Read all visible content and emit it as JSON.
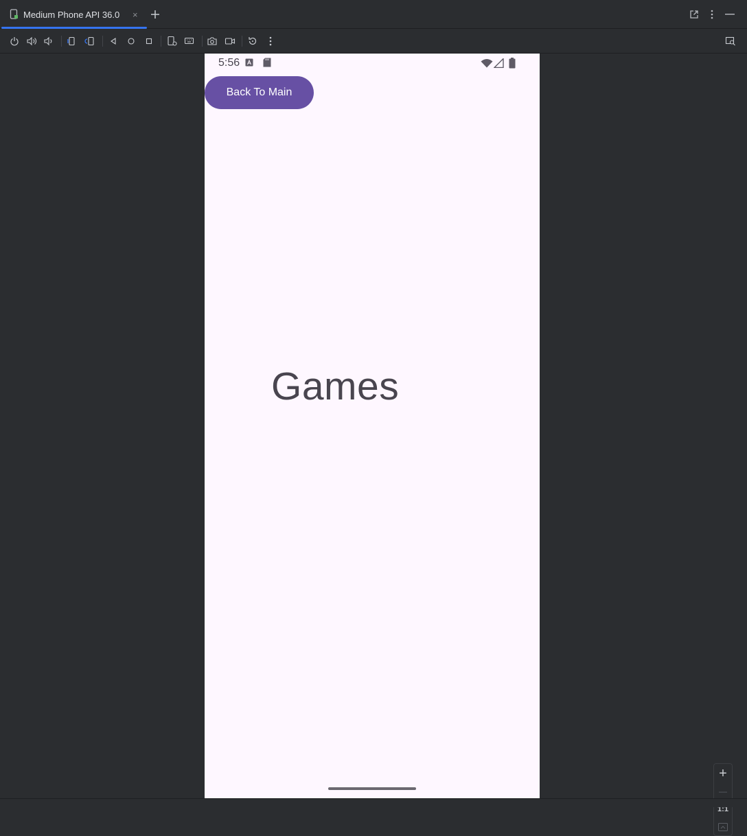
{
  "tab": {
    "title": "Medium Phone API 36.0",
    "close": "×"
  },
  "icons": {
    "device": "device-icon",
    "new_tab": "plus-icon",
    "open_external": "open-external-icon",
    "more": "more-vert-icon",
    "minimize": "minimize-icon",
    "toolbar": [
      "power-icon",
      "volume-up-icon",
      "volume-down-icon",
      "rotate-left-icon",
      "rotate-right-icon",
      "back-icon",
      "home-icon",
      "overview-icon",
      "device-settings-icon",
      "keyboard-icon",
      "screenshot-icon",
      "record-icon",
      "reset-icon",
      "more-vert-icon",
      "zoom-inspect-icon"
    ]
  },
  "phone": {
    "status_time": "5:56",
    "back_button": "Back To Main",
    "heading": "Games"
  },
  "zoom": {
    "plus": "+",
    "minus": "—",
    "one_to_one": "1:1"
  },
  "colors": {
    "ide_bg": "#2b2d30",
    "accent": "#3574f0",
    "phone_bg": "#fef7ff",
    "button": "#6750a4",
    "text": "#49454f"
  }
}
